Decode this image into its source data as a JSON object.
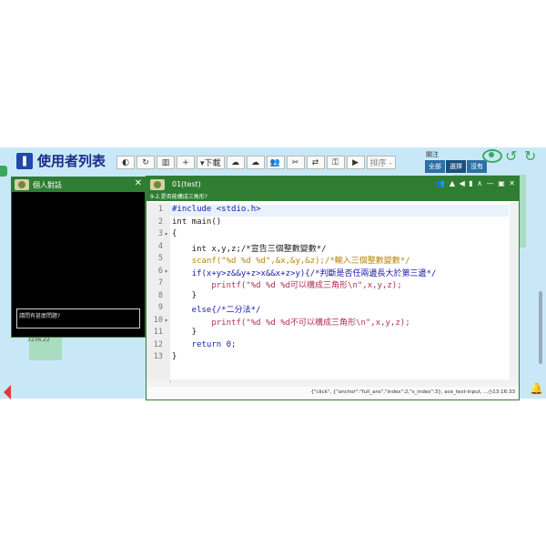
{
  "header": {
    "title": "使用者列表"
  },
  "toolbar": {
    "buttons": [
      {
        "name": "toggle-icon",
        "label": "◐"
      },
      {
        "name": "refresh-icon",
        "label": "↻"
      },
      {
        "name": "chart-icon",
        "label": "▥"
      },
      {
        "name": "plus-icon",
        "label": "+"
      },
      {
        "name": "download-button",
        "label": "▾下載"
      },
      {
        "name": "cloud-upload-icon",
        "label": "☁"
      },
      {
        "name": "cloud-download-icon",
        "label": "☁"
      },
      {
        "name": "users-icon",
        "label": "👥"
      },
      {
        "name": "scissors-icon",
        "label": "✂"
      },
      {
        "name": "swap-icon",
        "label": "⇄"
      },
      {
        "name": "key-icon",
        "label": "⚿"
      },
      {
        "name": "youtube-icon",
        "label": "▶"
      }
    ],
    "sort_label": "排序 -"
  },
  "filter": {
    "label": "關注",
    "options": [
      "全部",
      "選擇",
      "沒有"
    ]
  },
  "chat": {
    "title": "個人對話",
    "input_placeholder": "請問有甚麼問題?",
    "bg_number": "3236.22"
  },
  "code_window": {
    "title": "01(test)",
    "subtitle": "9-2.是否能構成三角形?",
    "controls": "👥 ▲ ◀ ▮ ∧ — ▣ ✕",
    "lines": [
      {
        "n": "1",
        "fold": "",
        "text": "#include <stdio.h>"
      },
      {
        "n": "2",
        "fold": "",
        "text": "int main()"
      },
      {
        "n": "3",
        "fold": "▾",
        "text": "{"
      },
      {
        "n": "4",
        "fold": "",
        "text": "    int x,y,z;/*宣告三個整數變數*/"
      },
      {
        "n": "5",
        "fold": "",
        "text": "    scanf(\"%d %d %d\",&x,&y,&z);/*輸入三個整數變數*/"
      },
      {
        "n": "6",
        "fold": "▾",
        "text": "    if(x+y>z&&y+z>x&&x+z>y){/*判斷是否任兩邊長大於第三邊*/"
      },
      {
        "n": "7",
        "fold": "",
        "text": "        printf(\"%d %d %d可以構成三角形\\n\",x,y,z);"
      },
      {
        "n": "8",
        "fold": "",
        "text": "    }"
      },
      {
        "n": "9",
        "fold": "",
        "text": "    else{/*二分法*/"
      },
      {
        "n": "10",
        "fold": "▾",
        "text": "        printf(\"%d %d %d不可以構成三角形\\n\",x,y,z);"
      },
      {
        "n": "11",
        "fold": "",
        "text": "    }"
      },
      {
        "n": "12",
        "fold": "",
        "text": "    return 0;"
      },
      {
        "n": "13",
        "fold": "",
        "text": "}"
      }
    ],
    "status": "{\"click\", {\"anchor\":\"full_ans\",\"index\":2,\"s_index\":3}, ace_text-input, ...◷13:16:33"
  },
  "colors": {
    "window_green": "#2f7d32",
    "app_bg": "#c9e8f7",
    "title_blue": "#1a2a8a"
  }
}
